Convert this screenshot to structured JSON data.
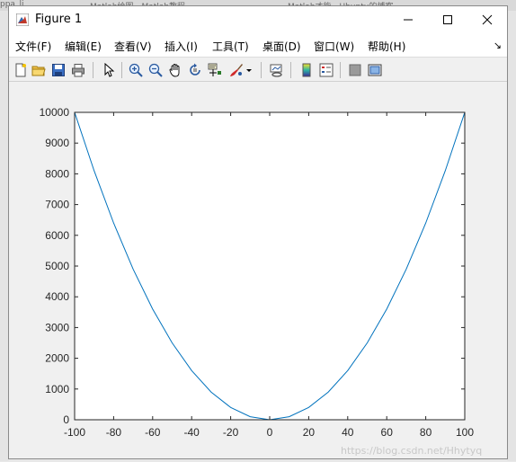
{
  "window": {
    "title": "Figure 1"
  },
  "background": {
    "tabs": [
      "ppa_li",
      "Matlab绘图 - Matlab教程",
      "Matlab才能 - Ubuntu的博客"
    ]
  },
  "menu": [
    {
      "label": "文件(F)"
    },
    {
      "label": "编辑(E)"
    },
    {
      "label": "查看(V)"
    },
    {
      "label": "插入(I)"
    },
    {
      "label": "工具(T)"
    },
    {
      "label": "桌面(D)"
    },
    {
      "label": "窗口(W)"
    },
    {
      "label": "帮助(H)"
    }
  ],
  "menu_overflow": "↘",
  "toolbar": {
    "icons": [
      "new-figure-icon",
      "open-file-icon",
      "save-icon",
      "print-icon",
      "select-arrow-icon",
      "zoom-in-icon",
      "zoom-out-icon",
      "pan-hand-icon",
      "rotate-3d-icon",
      "data-cursor-icon",
      "brush-icon",
      "brush-dropdown-icon",
      "link-plot-icon",
      "colorbar-icon",
      "legend-icon",
      "hide-plot-tools-icon",
      "show-plot-tools-icon"
    ]
  },
  "watermark": "https://blog.csdn.net/Hhytyq",
  "chart_data": {
    "type": "line",
    "x": [
      -100,
      -90,
      -80,
      -70,
      -60,
      -50,
      -40,
      -30,
      -20,
      -10,
      0,
      10,
      20,
      30,
      40,
      50,
      60,
      70,
      80,
      90,
      100
    ],
    "series": [
      {
        "values": [
          10000,
          8100,
          6400,
          4900,
          3600,
          2500,
          1600,
          900,
          400,
          100,
          0,
          100,
          400,
          900,
          1600,
          2500,
          3600,
          4900,
          6400,
          8100,
          10000
        ],
        "color": "#0072bd"
      }
    ],
    "xlim": [
      -100,
      100
    ],
    "ylim": [
      0,
      10000
    ],
    "xticks": [
      -100,
      -80,
      -60,
      -40,
      -20,
      0,
      20,
      40,
      60,
      80,
      100
    ],
    "yticks": [
      0,
      1000,
      2000,
      3000,
      4000,
      5000,
      6000,
      7000,
      8000,
      9000,
      10000
    ],
    "grid": false,
    "title": "",
    "xlabel": "",
    "ylabel": ""
  }
}
